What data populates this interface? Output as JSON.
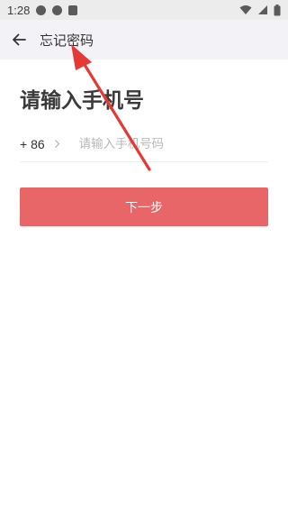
{
  "status_bar": {
    "time": "1:28"
  },
  "header": {
    "title": "忘记密码",
    "back_icon": "arrow-left-icon"
  },
  "main": {
    "heading": "请输入手机号",
    "country_code": "+ 86",
    "phone_placeholder": "请输入手机号码",
    "phone_value": "",
    "next_label": "下一步"
  },
  "colors": {
    "accent": "#e86668",
    "annotation": "#e53935",
    "header_bg": "#f3f3f7"
  }
}
